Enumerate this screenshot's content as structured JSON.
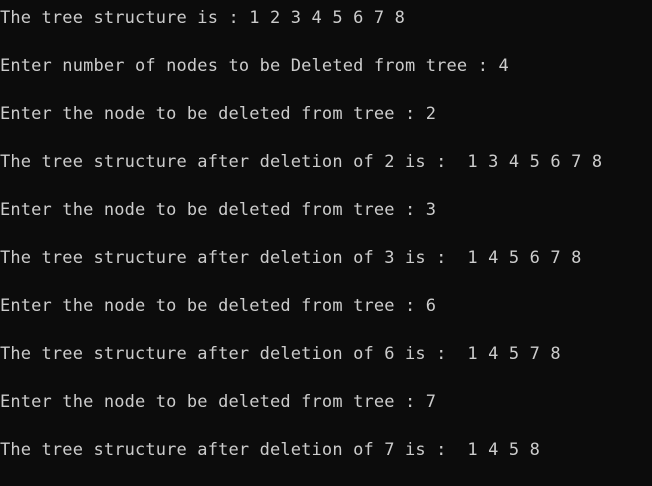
{
  "console": {
    "lines": [
      "The tree structure is : 1 2 3 4 5 6 7 8",
      "Enter number of nodes to be Deleted from tree : 4",
      "Enter the node to be deleted from tree : 2",
      "The tree structure after deletion of 2 is :  1 3 4 5 6 7 8",
      "Enter the node to be deleted from tree : 3",
      "The tree structure after deletion of 3 is :  1 4 5 6 7 8",
      "Enter the node to be deleted from tree : 6",
      "The tree structure after deletion of 6 is :  1 4 5 7 8",
      "Enter the node to be deleted from tree : 7",
      "The tree structure after deletion of 7 is :  1 4 5 8"
    ]
  },
  "colors": {
    "background": "#0c0c0c",
    "text": "#cccccc"
  }
}
